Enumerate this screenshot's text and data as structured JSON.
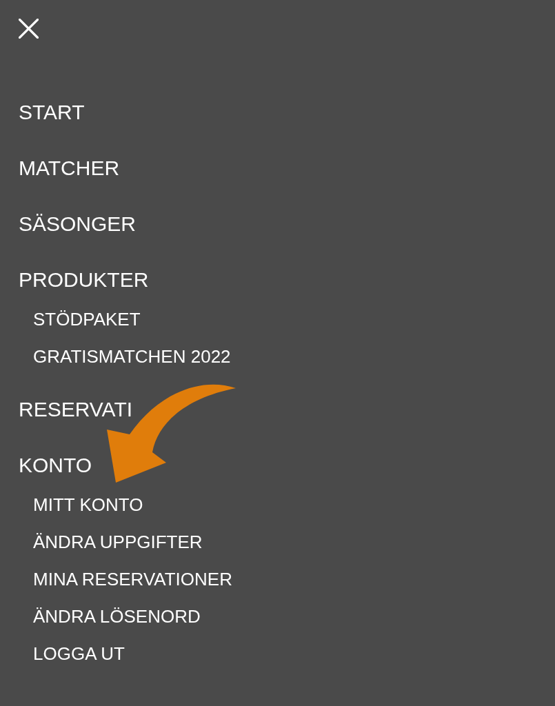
{
  "menu": {
    "items": [
      {
        "label": "START"
      },
      {
        "label": "MATCHER"
      },
      {
        "label": "SÄSONGER"
      },
      {
        "label": "PRODUKTER",
        "children": [
          {
            "label": "STÖDPAKET"
          },
          {
            "label": "GRATISMATCHEN 2022"
          }
        ]
      },
      {
        "label": "RESERVATI"
      },
      {
        "label": "KONTO",
        "children": [
          {
            "label": "MITT KONTO"
          },
          {
            "label": "ÄNDRA UPPGIFTER"
          },
          {
            "label": "MINA RESERVATIONER"
          },
          {
            "label": "ÄNDRA LÖSENORD"
          },
          {
            "label": "LOGGA UT"
          }
        ]
      }
    ]
  }
}
